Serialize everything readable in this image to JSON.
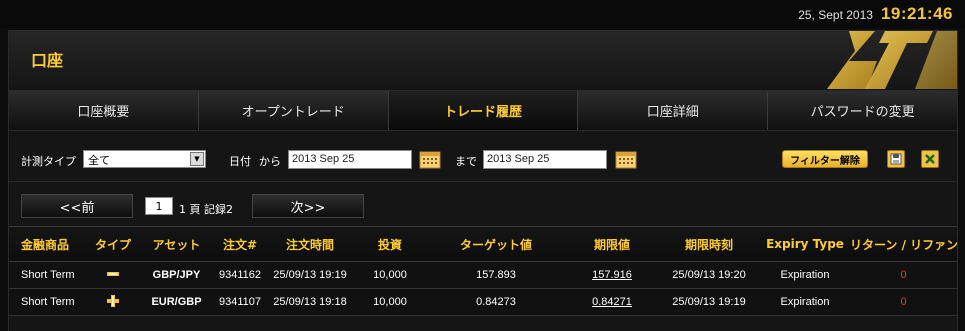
{
  "clock": {
    "date": "25, Sept 2013",
    "time": "19:21:46"
  },
  "header": {
    "title": "口座"
  },
  "tabs": [
    {
      "label": "口座概要"
    },
    {
      "label": "オープントレード"
    },
    {
      "label": "トレード履歴"
    },
    {
      "label": "口座詳細"
    },
    {
      "label": "パスワードの変更"
    }
  ],
  "filters": {
    "type_label": "計測タイプ",
    "type_value": "全て",
    "date_label": "日付",
    "from_label": "から",
    "from_value": "2013 Sep 25",
    "to_label": "まで",
    "to_value": "2013 Sep 25",
    "filter_button": "フィルター解除"
  },
  "pager": {
    "prev": "<<前",
    "page": "1",
    "info": "1 頁 記録2",
    "next": "次>>"
  },
  "table": {
    "headers": [
      "金融商品",
      "タイプ",
      "アセット",
      "注文#",
      "注文時間",
      "投資",
      "ターゲット値",
      "期限値",
      "期限時刻",
      "Expiry Type",
      "リターン / リファンド"
    ],
    "rows": [
      {
        "instrument": "Short Term",
        "type_icon": "down-arrow-icon",
        "asset": "GBP/JPY",
        "order": "9341162",
        "order_time": "25/09/13 19:19",
        "investment": "10,000",
        "target": "157.893",
        "expiry_value": "157.916",
        "expiry_time": "25/09/13 19:20",
        "expiry_type": "Expiration",
        "return": "0"
      },
      {
        "instrument": "Short Term",
        "type_icon": "up-arrow-icon",
        "asset": "EUR/GBP",
        "order": "9341107",
        "order_time": "25/09/13 19:18",
        "investment": "10,000",
        "target": "0.84273",
        "expiry_value": "0.84271",
        "expiry_time": "25/09/13 19:19",
        "expiry_type": "Expiration",
        "return": "0"
      }
    ]
  },
  "colors": {
    "accent": "#ffcc33",
    "negative": "#e0403a"
  }
}
